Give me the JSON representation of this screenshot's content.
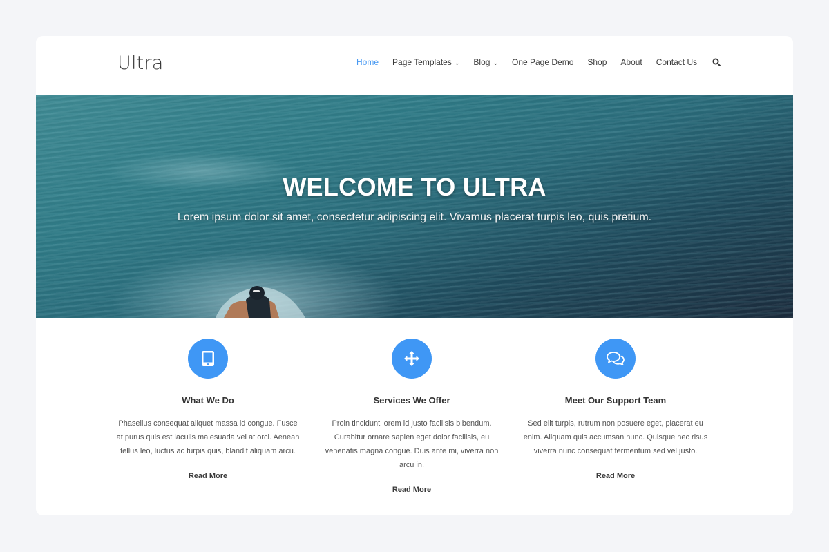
{
  "header": {
    "logo": "Ultra",
    "nav": [
      {
        "label": "Home",
        "active": true,
        "dropdown": false
      },
      {
        "label": "Page Templates",
        "active": false,
        "dropdown": true
      },
      {
        "label": "Blog",
        "active": false,
        "dropdown": true
      },
      {
        "label": "One Page Demo",
        "active": false,
        "dropdown": false
      },
      {
        "label": "Shop",
        "active": false,
        "dropdown": false
      },
      {
        "label": "About",
        "active": false,
        "dropdown": false
      },
      {
        "label": "Contact Us",
        "active": false,
        "dropdown": false
      }
    ],
    "dropdown_glyph": "⌄",
    "search_icon": "search-icon",
    "active_color": "#4a9af2"
  },
  "hero": {
    "title": "WELCOME TO ULTRA",
    "subtitle": "Lorem ipsum dolor sit amet, consectetur adipiscing elit. Vivamus placerat turpis leo, quis pretium.",
    "image": "ocean-surfer-photo"
  },
  "features": [
    {
      "icon": "tablet-icon",
      "title": "What We Do",
      "text": "Phasellus consequat aliquet massa id congue. Fusce at purus quis est iaculis malesuada vel at orci. Aenean tellus leo, luctus ac turpis quis, blandit aliquam arcu.",
      "link": "Read More"
    },
    {
      "icon": "arrows-move-icon",
      "title": "Services We Offer",
      "text": "Proin tincidunt lorem id justo facilisis bibendum. Curabitur ornare sapien eget dolor facilisis, eu venenatis magna congue. Duis ante mi, viverra non arcu in.",
      "link": "Read More"
    },
    {
      "icon": "chat-bubbles-icon",
      "title": "Meet Our Support Team",
      "text": "Sed elit turpis, rutrum non posuere eget, placerat eu enim. Aliquam quis accumsan nunc. Quisque nec risus viverra nunc consequat fermentum sed vel justo.",
      "link": "Read More"
    }
  ],
  "colors": {
    "accent": "#3f97f5",
    "page_background": "#f4f5f8",
    "text_dark": "#333333"
  }
}
